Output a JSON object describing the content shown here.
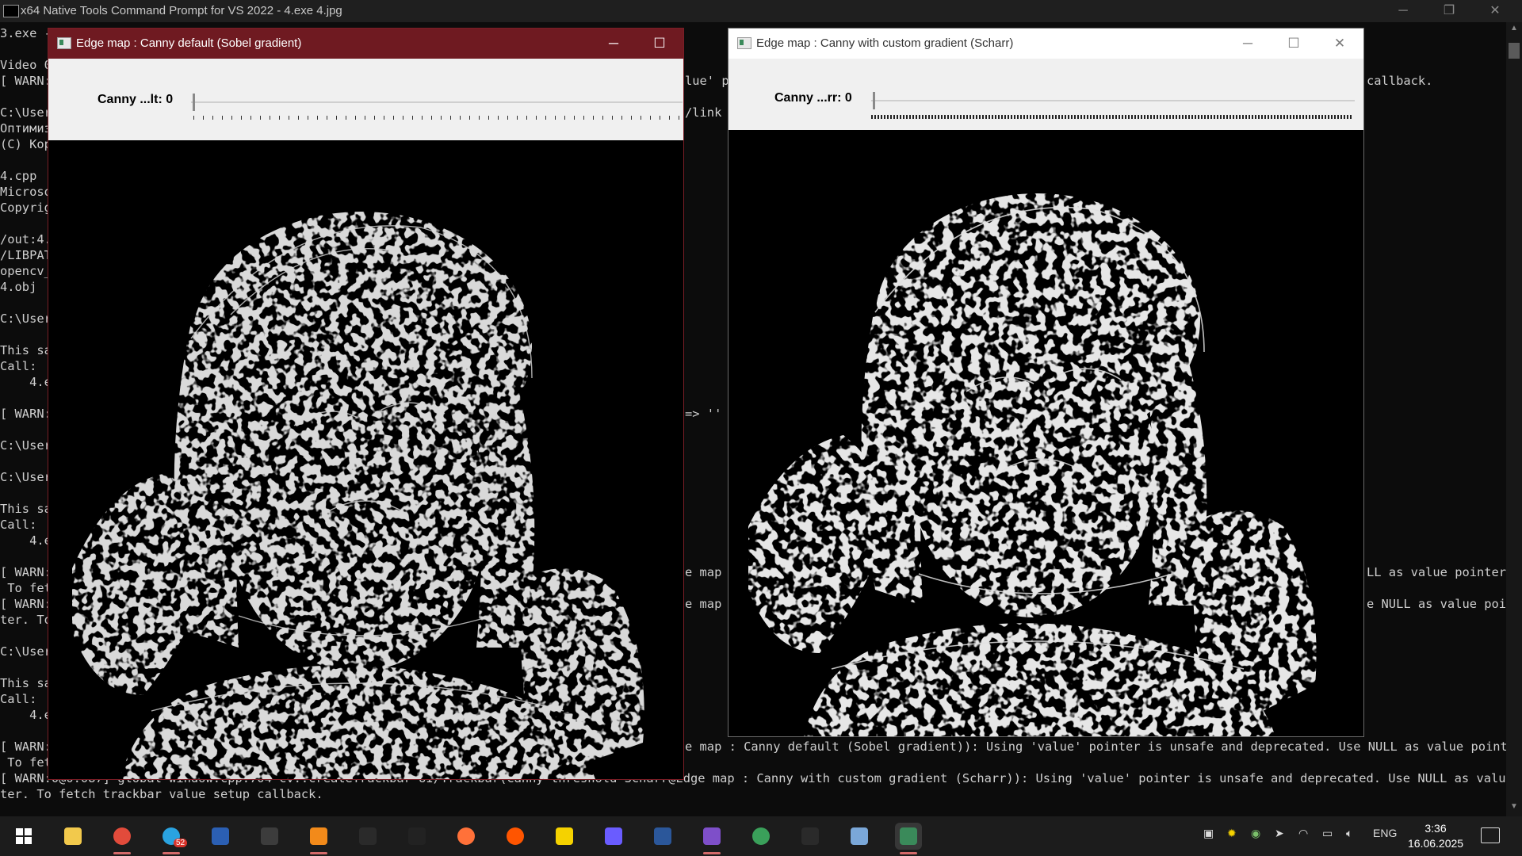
{
  "console": {
    "title": "x64 Native Tools Command Prompt for VS 2022 - 4.exe  4.jpg",
    "lines_left": [
      "3.exe -",
      "",
      "Video 0",
      "[ WARN:",
      "",
      "C:\\User",
      "Оптимиз",
      "(C) Кор",
      "",
      "4.cpp",
      "Microso",
      "Copyrig",
      "",
      "/out:4.",
      "/LIBPAT",
      "opencv_",
      "4.obj",
      "",
      "C:\\User",
      "",
      "This sa",
      "Call:",
      "    4.e",
      "",
      "[ WARN:",
      "",
      "C:\\User",
      "",
      "C:\\User",
      "",
      "This sa",
      "Call:",
      "    4.e",
      "",
      "[ WARN:",
      " To fet",
      "[ WARN:",
      "ter. To",
      "",
      "C:\\User",
      "",
      "This sa",
      "Call:",
      "    4.e",
      "",
      "[ WARN:",
      " To fet"
    ],
    "mid_fragments": [
      {
        "text": "lue' p",
        "row": 3
      },
      {
        "text": "/link",
        "row": 5
      },
      {
        "text": "=> ''",
        "row": 24
      },
      {
        "text": "e map",
        "row": 34
      },
      {
        "text": "e map :",
        "row": 36
      },
      {
        "text": "e map : Canny default (Sobel gradient)): Using 'value' pointer is unsafe and deprecated. Use NULL as value pointer.",
        "row": 45
      }
    ],
    "right_fragments": [
      {
        "text": "callback.",
        "row": 3
      },
      {
        "text": "LL as value pointer.",
        "row": 34
      },
      {
        "text": "e NULL as value poin",
        "row": 36
      }
    ],
    "bottom_lines": [
      "[ WARN:0@0.087] global window.cpp:704 cv::createTrackbar UI/Trackbar(Canny threshold Scharr@Edge map : Canny with custom gradient (Scharr)): Using 'value' pointer is unsafe and deprecated. Use NULL as value poin",
      "ter. To fetch trackbar value setup callback."
    ],
    "controls": {
      "minimize": "─",
      "restore": "❐",
      "close": "✕"
    }
  },
  "window_sobel": {
    "title": "Edge map : Canny default (Sobel gradient)",
    "trackbar_label": "Canny ...lt: 0",
    "trackbar_value": 0,
    "controls": {
      "minimize": "─",
      "maximize": "☐",
      "close": "✕"
    }
  },
  "window_scharr": {
    "title": "Edge map : Canny with custom gradient (Scharr)",
    "trackbar_label": "Canny ...rr: 0",
    "trackbar_value": 0,
    "controls": {
      "minimize": "─",
      "maximize": "☐",
      "close": "✕"
    }
  },
  "taskbar": {
    "apps": [
      {
        "name": "start",
        "color": "#ffffff"
      },
      {
        "name": "file-explorer",
        "color": "#f2c94c"
      },
      {
        "name": "chrome",
        "color": "#e24b3b"
      },
      {
        "name": "telegram",
        "color": "#2aa3e0",
        "badge": "52"
      },
      {
        "name": "powershell",
        "color": "#2b5fb3"
      },
      {
        "name": "terminal",
        "color": "#3c3c3c"
      },
      {
        "name": "sublime-text",
        "color": "#f28a1a"
      },
      {
        "name": "cmd",
        "color": "#2a2a2a"
      },
      {
        "name": "scrivener",
        "color": "#222222"
      },
      {
        "name": "firefox",
        "color": "#ff7139"
      },
      {
        "name": "soundcloud",
        "color": "#ff5500"
      },
      {
        "name": "sun-app",
        "color": "#f5d200"
      },
      {
        "name": "link-app",
        "color": "#6a5cff"
      },
      {
        "name": "word",
        "color": "#2b579a"
      },
      {
        "name": "visual-studio",
        "color": "#7e4fc9"
      },
      {
        "name": "chrome-canary",
        "color": "#3aa05a"
      },
      {
        "name": "cmd-2",
        "color": "#2a2a2a"
      },
      {
        "name": "photos",
        "color": "#7aa7d8"
      },
      {
        "name": "opencv-window",
        "color": "#3a8a5a"
      }
    ],
    "lang": "ENG",
    "time": "3:36",
    "date": "16.06.2025"
  },
  "colors": {
    "sobel_titlebar": "#6f1a21",
    "scharr_titlebar": "#ffffff",
    "console_bg": "#0c0c0c",
    "taskbar_bg": "#1c1c1c"
  }
}
